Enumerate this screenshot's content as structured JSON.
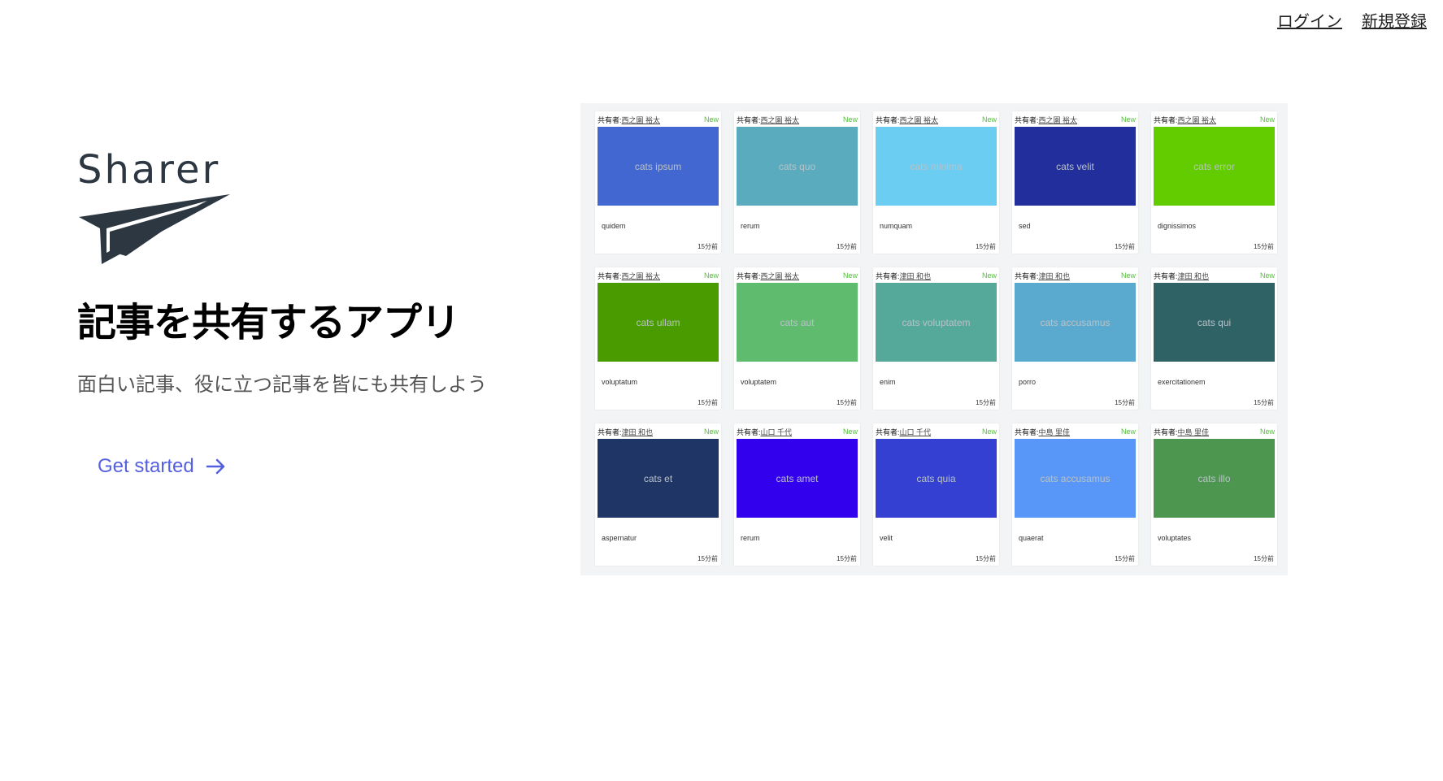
{
  "nav": {
    "login": "ログイン",
    "signup": "新規登録"
  },
  "brand": {
    "logo_text": "Sharer",
    "logo_icon": "paper-plane-icon",
    "logo_color": "#2d3742"
  },
  "hero": {
    "title": "記事を共有するアプリ",
    "subtitle": "面白い記事、役に立つ記事を皆にも共有しよう",
    "cta_label": "Get started",
    "cta_icon": "arrow-right-icon",
    "cta_color": "#5560e0"
  },
  "cards": [
    {
      "sharer_label": "共有者:",
      "sharer": "西之園 裕太",
      "badge": "New",
      "image_text": "cats ipsum",
      "image_color": "#4267d1",
      "title": "quidem",
      "time": "15分前"
    },
    {
      "sharer_label": "共有者:",
      "sharer": "西之園 裕太",
      "badge": "New",
      "image_text": "cats quo",
      "image_color": "#5aabbd",
      "title": "rerum",
      "time": "15分前"
    },
    {
      "sharer_label": "共有者:",
      "sharer": "西之園 裕太",
      "badge": "New",
      "image_text": "cats minima",
      "image_color": "#6bcdf2",
      "title": "numquam",
      "time": "15分前"
    },
    {
      "sharer_label": "共有者:",
      "sharer": "西之園 裕太",
      "badge": "New",
      "image_text": "cats velit",
      "image_color": "#222e9c",
      "title": "sed",
      "time": "15分前"
    },
    {
      "sharer_label": "共有者:",
      "sharer": "西之園 裕太",
      "badge": "New",
      "image_text": "cats error",
      "image_color": "#63cc00",
      "title": "dignissimos",
      "time": "15分前"
    },
    {
      "sharer_label": "共有者:",
      "sharer": "西之園 裕太",
      "badge": "New",
      "image_text": "cats ullam",
      "image_color": "#4a9b00",
      "title": "voluptatum",
      "time": "15分前"
    },
    {
      "sharer_label": "共有者:",
      "sharer": "西之園 裕太",
      "badge": "New",
      "image_text": "cats aut",
      "image_color": "#5fbb6e",
      "title": "voluptatem",
      "time": "15分前"
    },
    {
      "sharer_label": "共有者:",
      "sharer": "津田 和也",
      "badge": "New",
      "image_text": "cats voluptatem",
      "image_color": "#55a99a",
      "title": "enim",
      "time": "15分前"
    },
    {
      "sharer_label": "共有者:",
      "sharer": "津田 和也",
      "badge": "New",
      "image_text": "cats accusamus",
      "image_color": "#5aaad0",
      "title": "porro",
      "time": "15分前"
    },
    {
      "sharer_label": "共有者:",
      "sharer": "津田 和也",
      "badge": "New",
      "image_text": "cats qui",
      "image_color": "#2e6265",
      "title": "exercitationem",
      "time": "15分前"
    },
    {
      "sharer_label": "共有者:",
      "sharer": "津田 和也",
      "badge": "New",
      "image_text": "cats et",
      "image_color": "#1f3566",
      "title": "aspernatur",
      "time": "15分前"
    },
    {
      "sharer_label": "共有者:",
      "sharer": "山口 千代",
      "badge": "New",
      "image_text": "cats amet",
      "image_color": "#3300ee",
      "title": "rerum",
      "time": "15分前"
    },
    {
      "sharer_label": "共有者:",
      "sharer": "山口 千代",
      "badge": "New",
      "image_text": "cats quia",
      "image_color": "#3440d2",
      "title": "velit",
      "time": "15分前"
    },
    {
      "sharer_label": "共有者:",
      "sharer": "中島 里佳",
      "badge": "New",
      "image_text": "cats accusamus",
      "image_color": "#5896f7",
      "title": "quaerat",
      "time": "15分前"
    },
    {
      "sharer_label": "共有者:",
      "sharer": "中島 里佳",
      "badge": "New",
      "image_text": "cats illo",
      "image_color": "#4d964f",
      "title": "voluptates",
      "time": "15分前"
    }
  ]
}
